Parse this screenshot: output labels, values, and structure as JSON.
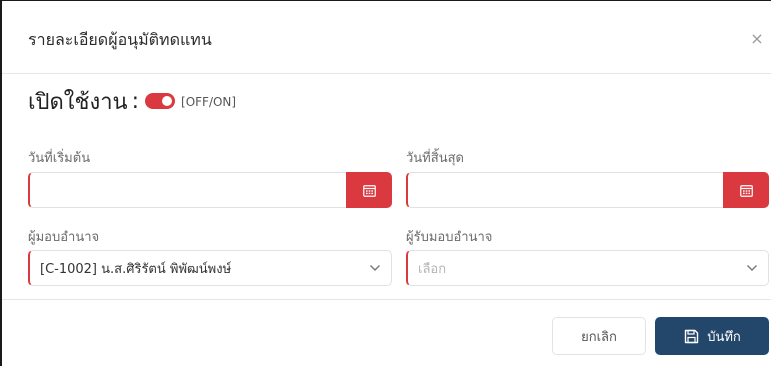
{
  "modal": {
    "title": "รายละเอียดผู้อนุมัติทดแทน",
    "close_label": "×"
  },
  "enable": {
    "label": "เปิดใช้งาน",
    "colon": ":",
    "toggle_on": true,
    "hint": "[OFF/ON]",
    "toggle_color": "#d9393f"
  },
  "fields": {
    "start_date": {
      "label": "วันที่เริ่มต้น",
      "value": "",
      "icon": "calendar-icon"
    },
    "end_date": {
      "label": "วันที่สิ้นสุด",
      "value": "",
      "icon": "calendar-icon"
    },
    "delegator": {
      "label": "ผู้มอบอำนาจ",
      "value": "[C-1002] น.ส.ศิริรัตน์ พิพัฒน์พงษ์",
      "icon": "chevron-down-icon"
    },
    "delegate": {
      "label": "ผู้รับมอบอำนาจ",
      "placeholder": "เลือก",
      "icon": "chevron-down-icon"
    }
  },
  "footer": {
    "cancel_label": "ยกเลิก",
    "save_label": "บันทึก",
    "save_icon": "floppy-disk-icon"
  },
  "colors": {
    "accent_red": "#d9393f",
    "primary_navy": "#23466b"
  }
}
